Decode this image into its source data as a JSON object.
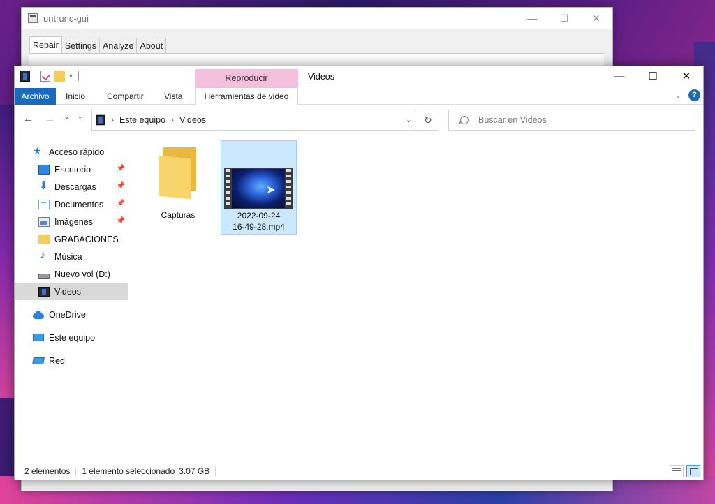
{
  "back_window": {
    "title": "untrunc-gui",
    "controls": [
      "—",
      "☐",
      "✕"
    ],
    "tabs": [
      {
        "label": "Repair",
        "active": true
      },
      {
        "label": "Settings",
        "active": false
      },
      {
        "label": "Analyze",
        "active": false
      },
      {
        "label": "About",
        "active": false
      }
    ]
  },
  "explorer": {
    "window_title": "Videos",
    "context_tab_head": "Reproducir",
    "controls": [
      "—",
      "☐",
      "✕"
    ],
    "ribbon_tabs": {
      "file": "Archivo",
      "home": "Inicio",
      "share": "Compartir",
      "view": "Vista",
      "context": "Herramientas de video"
    },
    "nav": {
      "back": "←",
      "forward": "→",
      "recent": "⌄",
      "up": "↑",
      "refresh": "↻",
      "address_dropdown": "⌄"
    },
    "breadcrumb": [
      "Este equipo",
      "Videos"
    ],
    "search_placeholder": "Buscar en Videos",
    "sidebar": {
      "quick_access": "Acceso rápido",
      "quick_items": [
        {
          "label": "Escritorio",
          "pinned": true,
          "icon": "desktop-icon"
        },
        {
          "label": "Descargas",
          "pinned": true,
          "icon": "downloads-icon"
        },
        {
          "label": "Documentos",
          "pinned": true,
          "icon": "documents-icon"
        },
        {
          "label": "Imágenes",
          "pinned": true,
          "icon": "pictures-icon"
        },
        {
          "label": "GRABACIONES",
          "pinned": false,
          "icon": "folder-icon"
        },
        {
          "label": "Música",
          "pinned": false,
          "icon": "music-icon"
        },
        {
          "label": "Nuevo vol (D:)",
          "pinned": false,
          "icon": "drive-icon"
        },
        {
          "label": "Videos",
          "pinned": false,
          "icon": "videos-icon",
          "selected": true
        }
      ],
      "onedrive": "OneDrive",
      "this_pc": "Este equipo",
      "network": "Red"
    },
    "files": [
      {
        "name": "Capturas",
        "type": "folder"
      },
      {
        "name_line1": "2022-09-24",
        "name_line2": "16-49-28.mp4",
        "type": "video",
        "selected": true
      }
    ],
    "status": {
      "count": "2 elementos",
      "selection": "1 elemento seleccionado",
      "size": "3.07 GB"
    }
  },
  "colors": {
    "accent": "#1a6bc0",
    "context_tab": "#f4c0dd",
    "selection": "#cce8ff"
  }
}
